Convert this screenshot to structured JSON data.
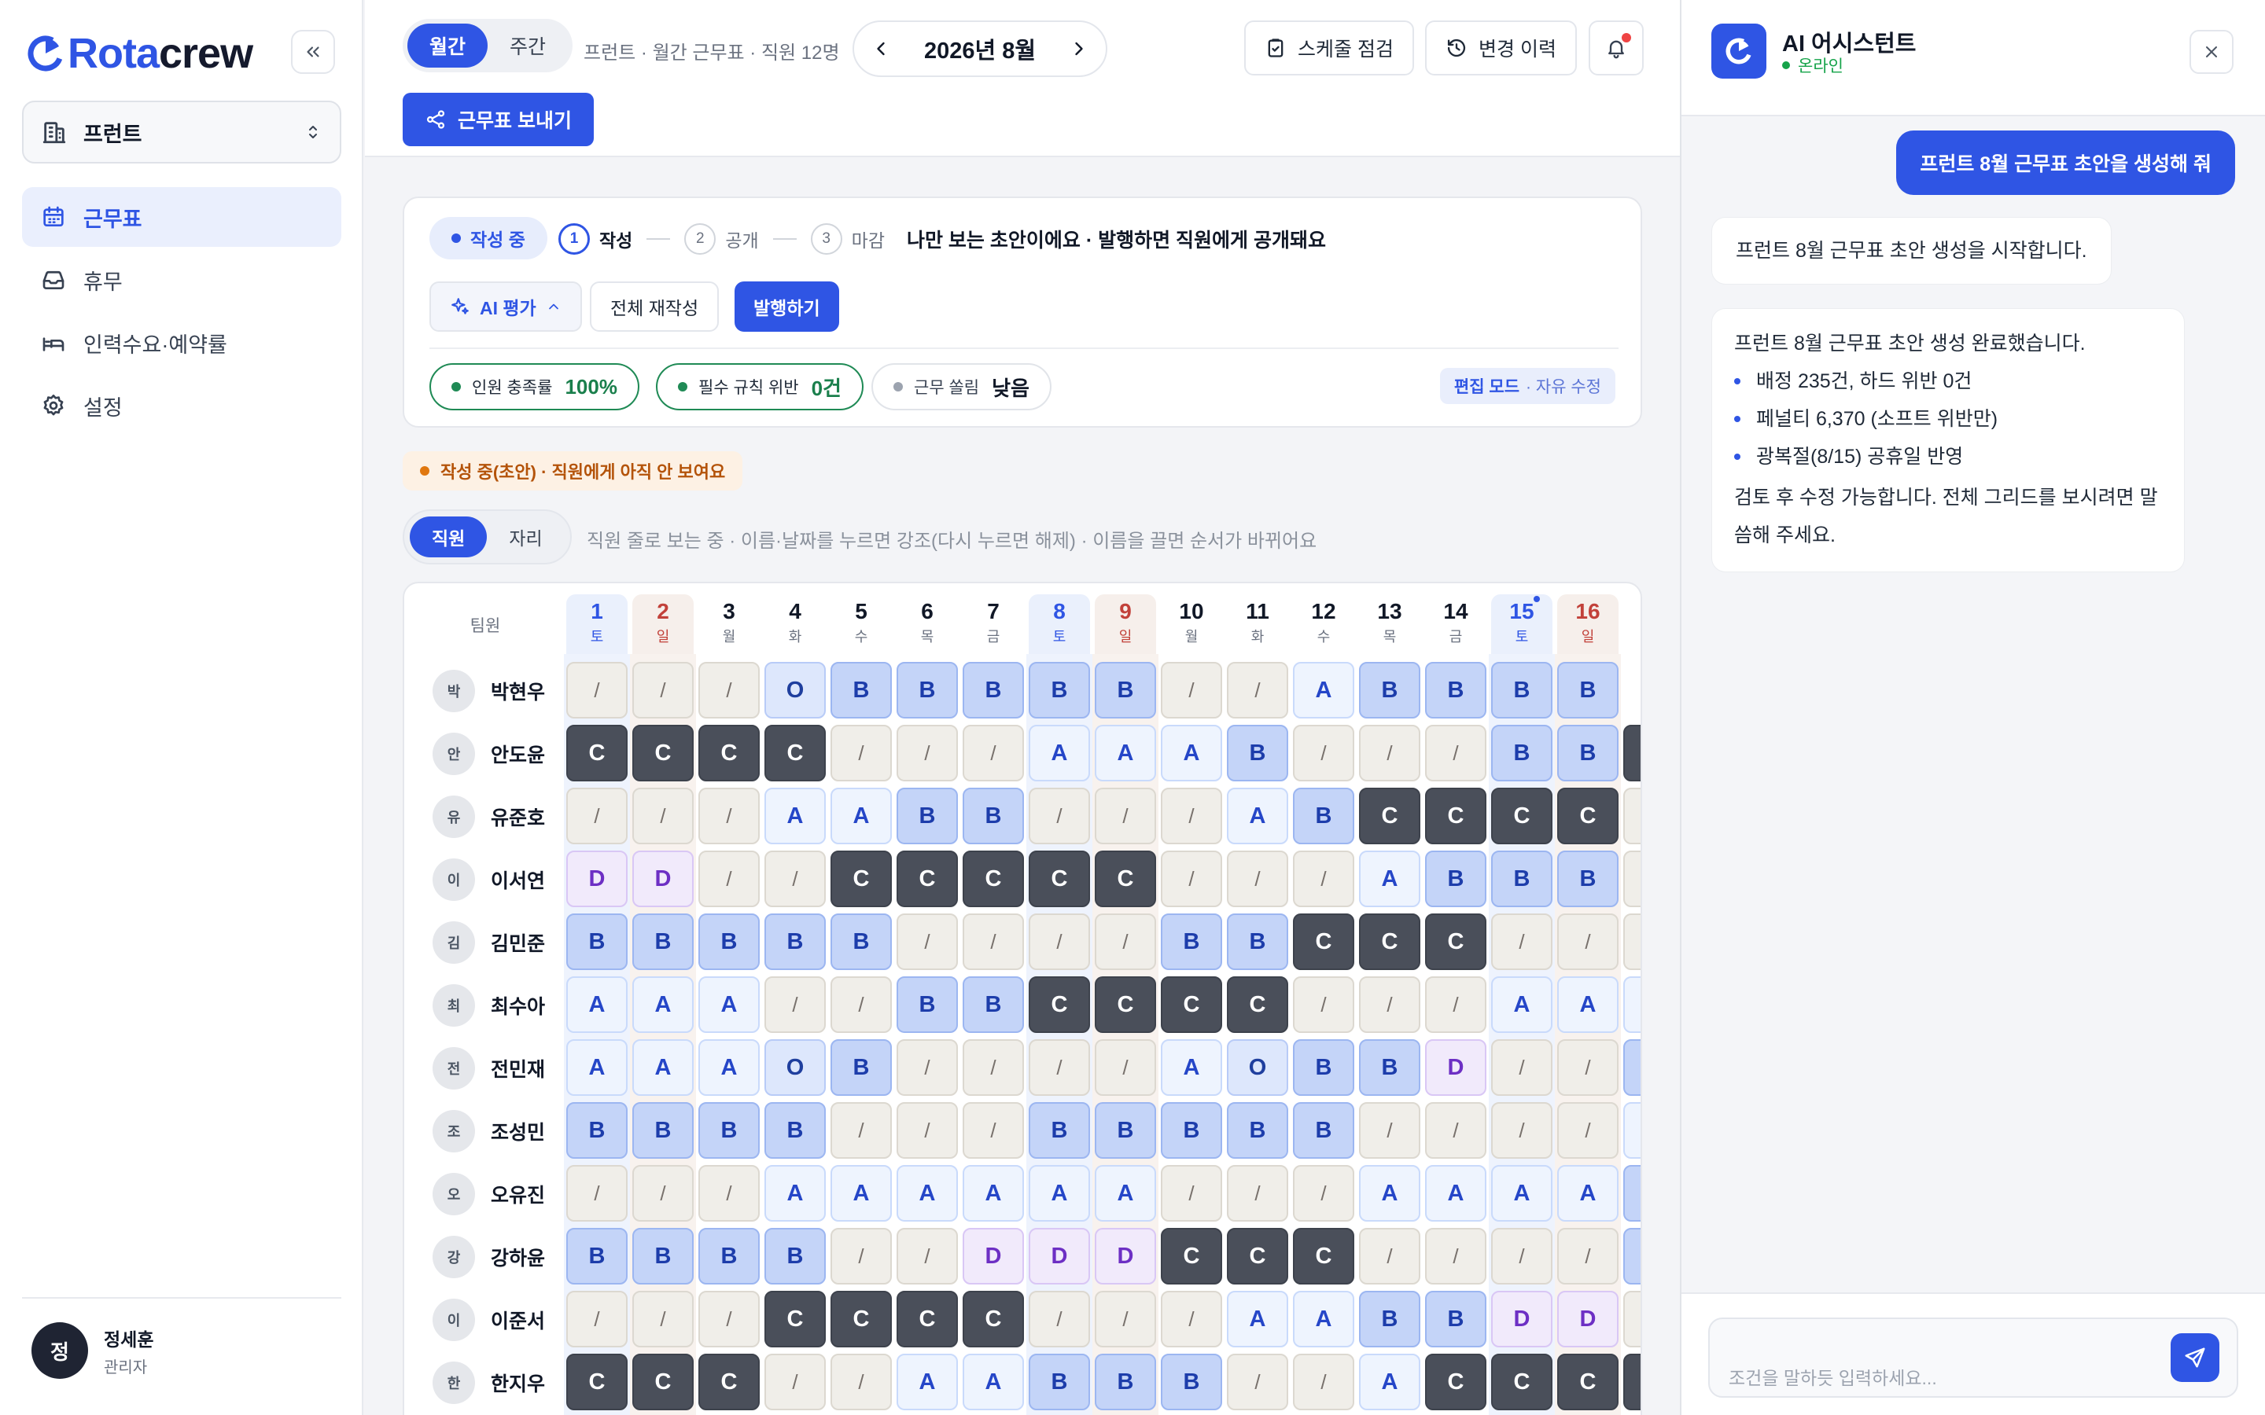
{
  "sidebar": {
    "brand_main": "Rota",
    "brand_accent": "crew",
    "store": "프런트",
    "nav": [
      {
        "label": "근무표",
        "icon": "calendar-icon",
        "active": true
      },
      {
        "label": "휴무",
        "icon": "inbox-icon",
        "active": false
      },
      {
        "label": "인력수요·예약률",
        "icon": "bed-icon",
        "active": false
      },
      {
        "label": "설정",
        "icon": "gear-icon",
        "active": false
      }
    ],
    "user": {
      "avatar": "정",
      "name": "정세훈",
      "role": "관리자"
    }
  },
  "header": {
    "view_monthly": "월간",
    "view_weekly": "주간",
    "breadcrumb": "프런트 · 월간 근무표 · 직원 12명",
    "month": "2026년 8월",
    "check_btn": "스케줄 점검",
    "history_btn": "변경 이력",
    "send_btn": "근무표 보내기"
  },
  "status_card": {
    "status": "작성 중",
    "steps": [
      {
        "num": "1",
        "label": "작성"
      },
      {
        "num": "2",
        "label": "공개"
      },
      {
        "num": "3",
        "label": "마감"
      }
    ],
    "note": "나만 보는 초안이에요 · 발행하면 직원에게 공개돼요",
    "ai_eval": "AI 평가",
    "regenerate": "전체 재작성",
    "publish": "발행하기",
    "metrics": [
      {
        "label": "인원 충족률",
        "value": "100%"
      },
      {
        "label": "필수 규칙 위반",
        "value": "0건"
      },
      {
        "label": "근무 쏠림",
        "value": "낮음"
      }
    ],
    "edit_mode": "편집 모드",
    "edit_mode_sub": "· 자유 수정"
  },
  "draft_warning": "작성 중(초안) · 직원에게 아직 안 보여요",
  "view_toggle": {
    "by_employee": "직원",
    "by_seat": "자리"
  },
  "view_hint": "직원 줄로 보는 중 · 이름·날짜를 누르면 강조(다시 누르면 해제) · 이름을 끌면 순서가 바뀌어요",
  "grid": {
    "team_header": "팀원",
    "days": [
      {
        "n": "1",
        "w": "토",
        "type": "sat"
      },
      {
        "n": "2",
        "w": "일",
        "type": "sun"
      },
      {
        "n": "3",
        "w": "월",
        "type": ""
      },
      {
        "n": "4",
        "w": "화",
        "type": ""
      },
      {
        "n": "5",
        "w": "수",
        "type": ""
      },
      {
        "n": "6",
        "w": "목",
        "type": ""
      },
      {
        "n": "7",
        "w": "금",
        "type": ""
      },
      {
        "n": "8",
        "w": "토",
        "type": "sat"
      },
      {
        "n": "9",
        "w": "일",
        "type": "sun"
      },
      {
        "n": "10",
        "w": "월",
        "type": ""
      },
      {
        "n": "11",
        "w": "화",
        "type": ""
      },
      {
        "n": "12",
        "w": "수",
        "type": ""
      },
      {
        "n": "13",
        "w": "목",
        "type": ""
      },
      {
        "n": "14",
        "w": "금",
        "type": ""
      },
      {
        "n": "15",
        "w": "토",
        "type": "sat",
        "holiday": true
      },
      {
        "n": "16",
        "w": "일",
        "type": "sun"
      }
    ],
    "rows": [
      {
        "avatar": "박",
        "name": "박현우",
        "shifts": [
          "/",
          "/",
          "/",
          "O",
          "B",
          "B",
          "B",
          "B",
          "B",
          "/",
          "/",
          "A",
          "B",
          "B",
          "B",
          "B"
        ],
        "overflow": ""
      },
      {
        "avatar": "안",
        "name": "안도윤",
        "shifts": [
          "C",
          "C",
          "C",
          "C",
          "/",
          "/",
          "/",
          "A",
          "A",
          "A",
          "B",
          "/",
          "/",
          "/",
          "B",
          "B"
        ],
        "overflow": "C"
      },
      {
        "avatar": "유",
        "name": "유준호",
        "shifts": [
          "/",
          "/",
          "/",
          "A",
          "A",
          "B",
          "B",
          "/",
          "/",
          "/",
          "A",
          "B",
          "C",
          "C",
          "C",
          "C"
        ],
        "overflow": "/"
      },
      {
        "avatar": "이",
        "name": "이서연",
        "shifts": [
          "D",
          "D",
          "/",
          "/",
          "C",
          "C",
          "C",
          "C",
          "C",
          "/",
          "/",
          "/",
          "A",
          "B",
          "B",
          "B"
        ],
        "overflow": "/"
      },
      {
        "avatar": "김",
        "name": "김민준",
        "shifts": [
          "B",
          "B",
          "B",
          "B",
          "B",
          "/",
          "/",
          "/",
          "/",
          "B",
          "B",
          "C",
          "C",
          "C",
          "/",
          "/"
        ],
        "overflow": "/"
      },
      {
        "avatar": "최",
        "name": "최수아",
        "shifts": [
          "A",
          "A",
          "A",
          "/",
          "/",
          "B",
          "B",
          "C",
          "C",
          "C",
          "C",
          "/",
          "/",
          "/",
          "A",
          "A"
        ],
        "overflow": "A"
      },
      {
        "avatar": "전",
        "name": "전민재",
        "shifts": [
          "A",
          "A",
          "A",
          "O",
          "B",
          "/",
          "/",
          "/",
          "/",
          "A",
          "O",
          "B",
          "B",
          "D",
          "/",
          "/"
        ],
        "overflow": "B"
      },
      {
        "avatar": "조",
        "name": "조성민",
        "shifts": [
          "B",
          "B",
          "B",
          "B",
          "/",
          "/",
          "/",
          "B",
          "B",
          "B",
          "B",
          "B",
          "/",
          "/",
          "/",
          "/"
        ],
        "overflow": "A"
      },
      {
        "avatar": "오",
        "name": "오유진",
        "shifts": [
          "/",
          "/",
          "/",
          "A",
          "A",
          "A",
          "A",
          "A",
          "A",
          "/",
          "/",
          "/",
          "A",
          "A",
          "A",
          "A"
        ],
        "overflow": "B"
      },
      {
        "avatar": "강",
        "name": "강하윤",
        "shifts": [
          "B",
          "B",
          "B",
          "B",
          "/",
          "/",
          "D",
          "D",
          "D",
          "C",
          "C",
          "C",
          "/",
          "/",
          "/",
          "/"
        ],
        "overflow": "B"
      },
      {
        "avatar": "이",
        "name": "이준서",
        "shifts": [
          "/",
          "/",
          "/",
          "C",
          "C",
          "C",
          "C",
          "/",
          "/",
          "/",
          "A",
          "A",
          "B",
          "B",
          "D",
          "D"
        ],
        "overflow": "/"
      },
      {
        "avatar": "한",
        "name": "한지우",
        "shifts": [
          "C",
          "C",
          "C",
          "/",
          "/",
          "A",
          "A",
          "B",
          "B",
          "B",
          "/",
          "/",
          "A",
          "C",
          "C",
          "C"
        ],
        "overflow": "C"
      }
    ]
  },
  "assistant": {
    "title": "AI 어시스턴트",
    "status": "온라인",
    "user_message": "프런트 8월 근무표 초안을 생성해 줘",
    "bot_message_1": "프런트 8월 근무표 초안 생성을 시작합니다.",
    "bot_message_2": {
      "intro": "프런트 8월 근무표 초안 생성 완료했습니다.",
      "bullets": [
        "배정 235건, 하드 위반 0건",
        "페널티 6,370 (소프트 위반만)",
        "광복절(8/15) 공휴일 반영"
      ],
      "outro": "검토 후 수정 가능합니다. 전체 그리드를 보시려면 말씀해 주세요."
    },
    "input_placeholder": "조건을 말하듯 입력하세요..."
  },
  "colors": {
    "accent": "#2f55e4",
    "success": "#1f8a55",
    "warning": "#e0770e",
    "dark_shift": "#4a4f5a"
  }
}
